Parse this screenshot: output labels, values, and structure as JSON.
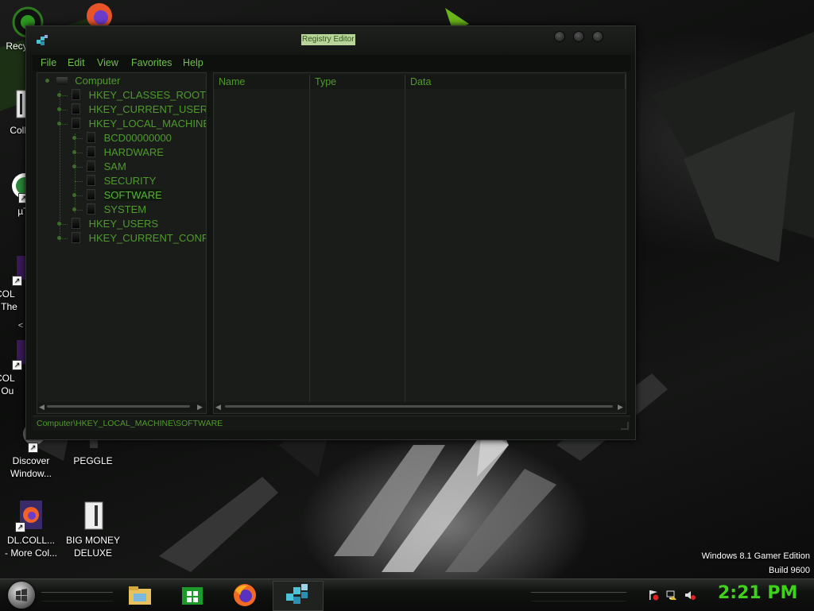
{
  "colors": {
    "accent_green": "#4f9a2c",
    "clock_green": "#3ed21a",
    "title_bg": "#b8d49a"
  },
  "desktop": {
    "icons": [
      {
        "label": "Recy",
        "icon": "recycle-bin-icon"
      },
      {
        "label": "Colla",
        "icon": "collection-folder-icon"
      },
      {
        "label": "µTo",
        "icon": "utorrent-icon"
      },
      {
        "label_line1": "COL",
        "label_line2": "- The",
        "icon": "collection-shortcut-icon"
      },
      {
        "label_line1": "COL",
        "label_line2": "- Ou",
        "icon": "collection-shortcut-icon"
      },
      {
        "label_line1": "Discover",
        "label_line2": "Window...",
        "icon": "discover-windows-icon"
      },
      {
        "label": "PEGGLE",
        "icon": "peggle-icon"
      },
      {
        "label_line1": "DL.COLL...",
        "label_line2": "- More Col...",
        "icon": "firefox-file-icon"
      },
      {
        "label_line1": "BIG MONEY",
        "label_line2": "DELUXE",
        "icon": "big-money-icon"
      }
    ],
    "nav_glyph": "< ↕ >",
    "edition_line1": "Windows 8.1 Gamer Edition",
    "edition_line2": "Build 9600"
  },
  "window": {
    "title": "Registry Editor",
    "title_icon": "registry-editor-icon",
    "menu": [
      "File",
      "Edit",
      "View",
      "Favorites",
      "Help"
    ],
    "tree": {
      "root": "Computer",
      "hives": [
        "HKEY_CLASSES_ROOT",
        "HKEY_CURRENT_USER",
        "HKEY_LOCAL_MACHINE",
        "HKEY_USERS",
        "HKEY_CURRENT_CONFI"
      ],
      "hklm_children": [
        "BCD00000000",
        "HARDWARE",
        "SAM",
        "SECURITY",
        "SOFTWARE",
        "SYSTEM"
      ],
      "selected": "SOFTWARE"
    },
    "columns": [
      "Name",
      "Type",
      "Data"
    ],
    "status_path": "Computer\\HKEY_LOCAL_MACHINE\\SOFTWARE"
  },
  "taskbar": {
    "start_icon": "windows-start-icon",
    "pinned": [
      {
        "name": "file-explorer-icon"
      },
      {
        "name": "store-icon"
      },
      {
        "name": "firefox-icon"
      },
      {
        "name": "registry-editor-icon",
        "active": true
      }
    ],
    "tray_icons": [
      "action-center-flag-icon",
      "network-icon",
      "volume-muted-icon"
    ],
    "clock": "2:21 PM"
  }
}
